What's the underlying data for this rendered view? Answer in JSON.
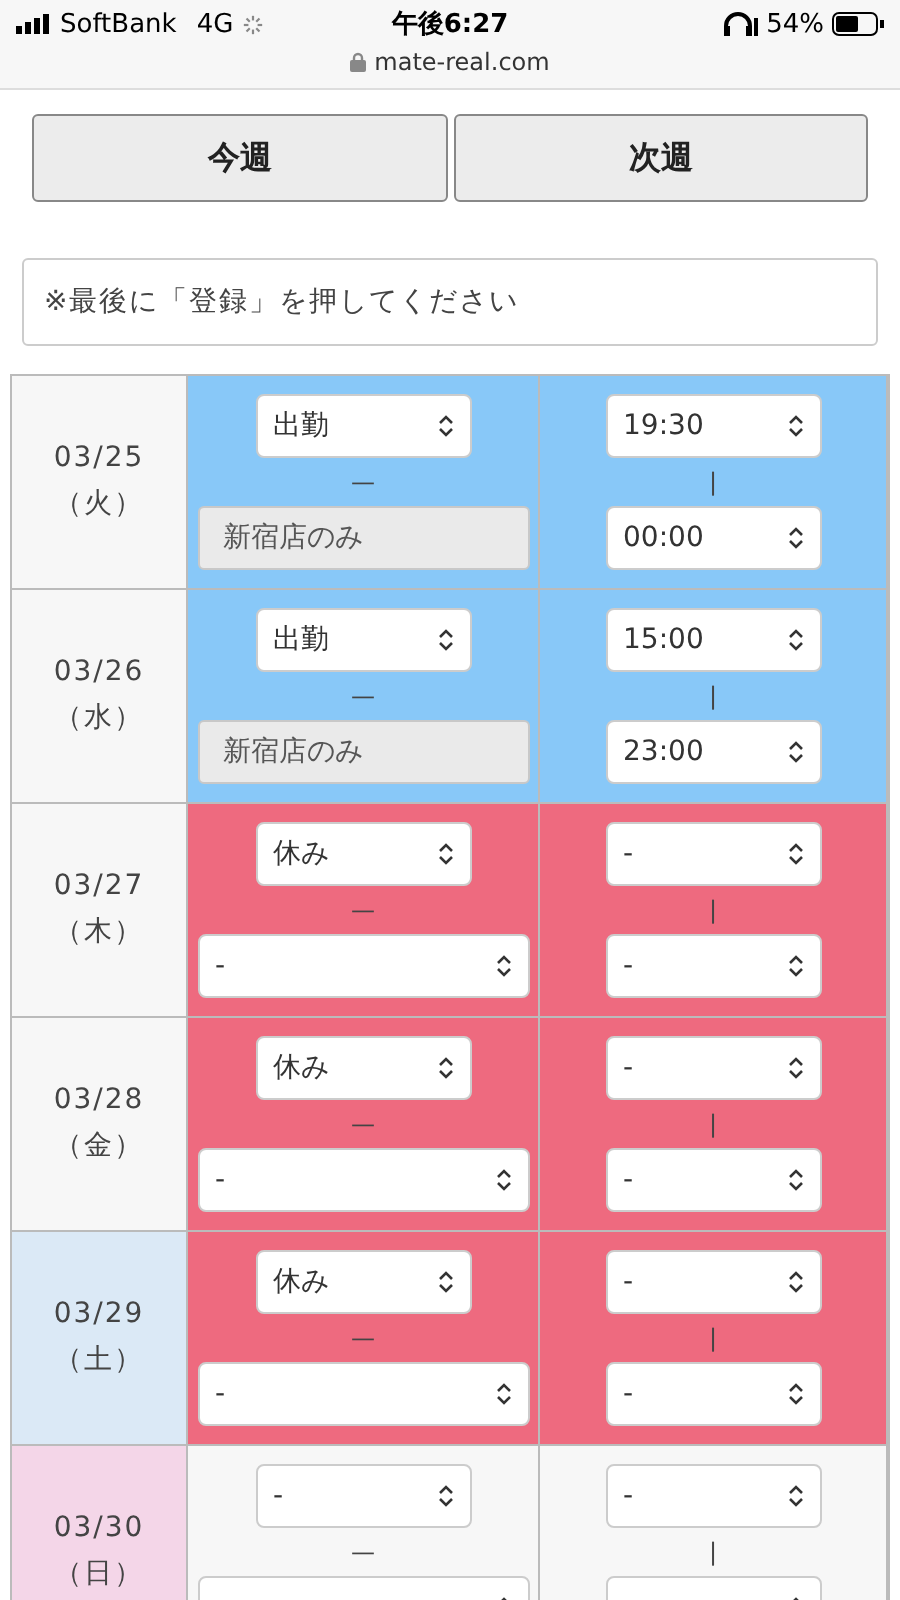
{
  "status_bar": {
    "carrier": "SoftBank",
    "network": "4G",
    "time": "午後6:27",
    "battery": "54%",
    "url": "mate-real.com"
  },
  "week_buttons": [
    "今週",
    "次週"
  ],
  "notice": "※最後に「登録」を押してください",
  "days": [
    {
      "date": "03/25",
      "weekday": "（火）",
      "kind": "weekday",
      "color": "#88c8f8",
      "status": "出勤",
      "dash": "—",
      "store": {
        "kind": "label",
        "value": "新宿店のみ"
      },
      "start": "19:30",
      "sep": "|",
      "end": "00:00"
    },
    {
      "date": "03/26",
      "weekday": "（水）",
      "kind": "weekday",
      "color": "#88c8f8",
      "status": "出勤",
      "dash": "—",
      "store": {
        "kind": "label",
        "value": "新宿店のみ"
      },
      "start": "15:00",
      "sep": "|",
      "end": "23:00"
    },
    {
      "date": "03/27",
      "weekday": "（木）",
      "kind": "weekday",
      "color": "#ee6a7f",
      "status": "休み",
      "dash": "—",
      "store": {
        "kind": "select",
        "value": "-"
      },
      "start": "-",
      "sep": "|",
      "end": "-"
    },
    {
      "date": "03/28",
      "weekday": "（金）",
      "kind": "weekday",
      "color": "#ee6a7f",
      "status": "休み",
      "dash": "—",
      "store": {
        "kind": "select",
        "value": "-"
      },
      "start": "-",
      "sep": "|",
      "end": "-"
    },
    {
      "date": "03/29",
      "weekday": "（土）",
      "kind": "saturday",
      "color": "#ee6a7f",
      "status": "休み",
      "dash": "—",
      "store": {
        "kind": "select",
        "value": "-"
      },
      "start": "-",
      "sep": "|",
      "end": "-"
    },
    {
      "date": "03/30",
      "weekday": "（日）",
      "kind": "sunday",
      "color": "#f7f7f7",
      "status": "-",
      "dash": "—",
      "store": {
        "kind": "select"
      },
      "start": "-",
      "sep": "|"
    }
  ]
}
